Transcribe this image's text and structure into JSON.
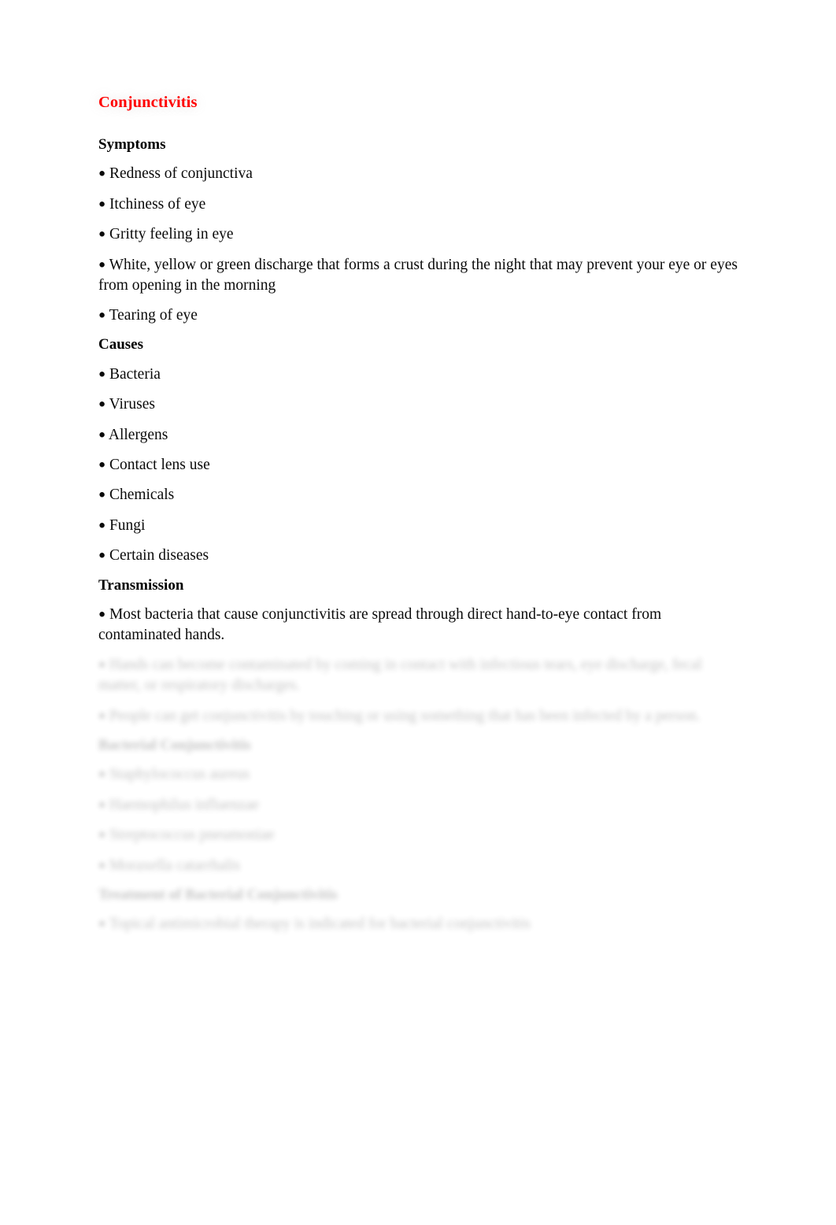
{
  "document": {
    "title": "Conjunctivitis",
    "title_color": "#ff0000",
    "body_color": "#000000",
    "background_color": "#ffffff",
    "bullet_glyph": "●"
  },
  "sections": {
    "symptoms": {
      "heading": "Symptoms",
      "items": [
        "Redness of conjunctiva",
        "Itchiness of eye",
        "Gritty feeling in eye",
        "White, yellow or green discharge that forms a crust during the night that may prevent your eye or eyes from opening in the morning",
        "Tearing of eye"
      ]
    },
    "causes": {
      "heading": "Causes",
      "items": [
        "Bacteria",
        "Viruses",
        "Allergens",
        "Contact lens use",
        "Chemicals",
        "Fungi",
        "Certain diseases"
      ]
    },
    "transmission": {
      "heading": "Transmission",
      "items": [
        "Most bacteria that cause conjunctivitis are spread through direct hand-to-eye contact from contaminated hands."
      ]
    },
    "transmission_obscured": {
      "items": [
        "Hands can become contaminated by coming in contact with infectious tears, eye discharge, fecal matter, or respiratory discharges.",
        "People can get conjunctivitis by touching or using something that has been infected by a person."
      ]
    },
    "bacterial_conjunctivitis": {
      "heading": "Bacterial Conjunctivitis",
      "items": [
        "Staphylococcus aureus",
        "Haemophilus influenzae",
        "Streptococcus pneumoniae",
        "Moraxella catarrhalis"
      ]
    },
    "treatment": {
      "heading": "Treatment of Bacterial Conjunctivitis",
      "items": [
        "Topical antimicrobial therapy is indicated for bacterial conjunctivitis"
      ]
    }
  }
}
